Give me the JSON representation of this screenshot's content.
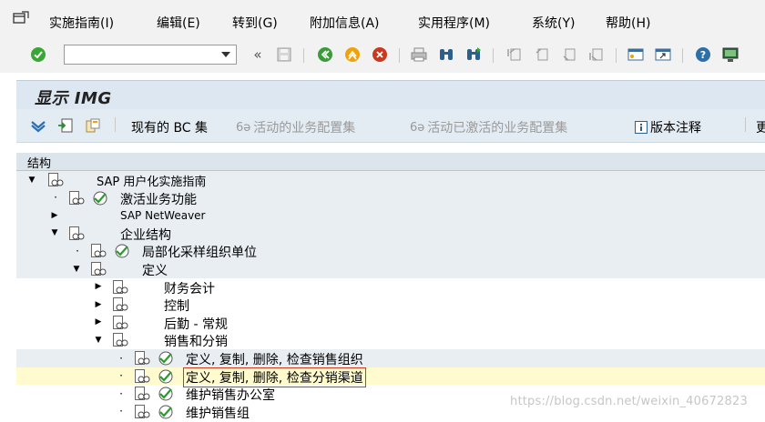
{
  "menubar": {
    "items": [
      {
        "label": "实施指南(I)"
      },
      {
        "label": "编辑(E)"
      },
      {
        "label": "转到(G)"
      },
      {
        "label": "附加信息(A)"
      },
      {
        "label": "实用程序(M)"
      },
      {
        "label": "系统(Y)"
      },
      {
        "label": "帮助(H)"
      }
    ]
  },
  "toolbar": {
    "command_value": ""
  },
  "screen": {
    "title": "显示 IMG"
  },
  "app_toolbar": {
    "current_bc_set": "现有的 BC 集",
    "active_bc_sets": "活动的业务配置集",
    "activated_bc_sets": "活动已激活的业务配置集",
    "release_notes": "版本注释",
    "more": "更"
  },
  "tree": {
    "header": "结构",
    "nodes": [
      {
        "label": "SAP 用户化实施指南"
      },
      {
        "label": "激活业务功能"
      },
      {
        "label": "SAP NetWeaver"
      },
      {
        "label": "企业结构"
      },
      {
        "label": "局部化采样组织单位"
      },
      {
        "label": "定义"
      },
      {
        "label": "财务会计"
      },
      {
        "label": "控制"
      },
      {
        "label": "后勤 - 常规"
      },
      {
        "label": "销售和分销"
      },
      {
        "label": "定义, 复制, 删除, 检查销售组织"
      },
      {
        "label": "定义, 复制, 删除, 检查分销渠道"
      },
      {
        "label": "维护销售办公室"
      },
      {
        "label": "维护销售组"
      }
    ]
  },
  "watermark": "https://blog.csdn.net/weixin_40672823"
}
